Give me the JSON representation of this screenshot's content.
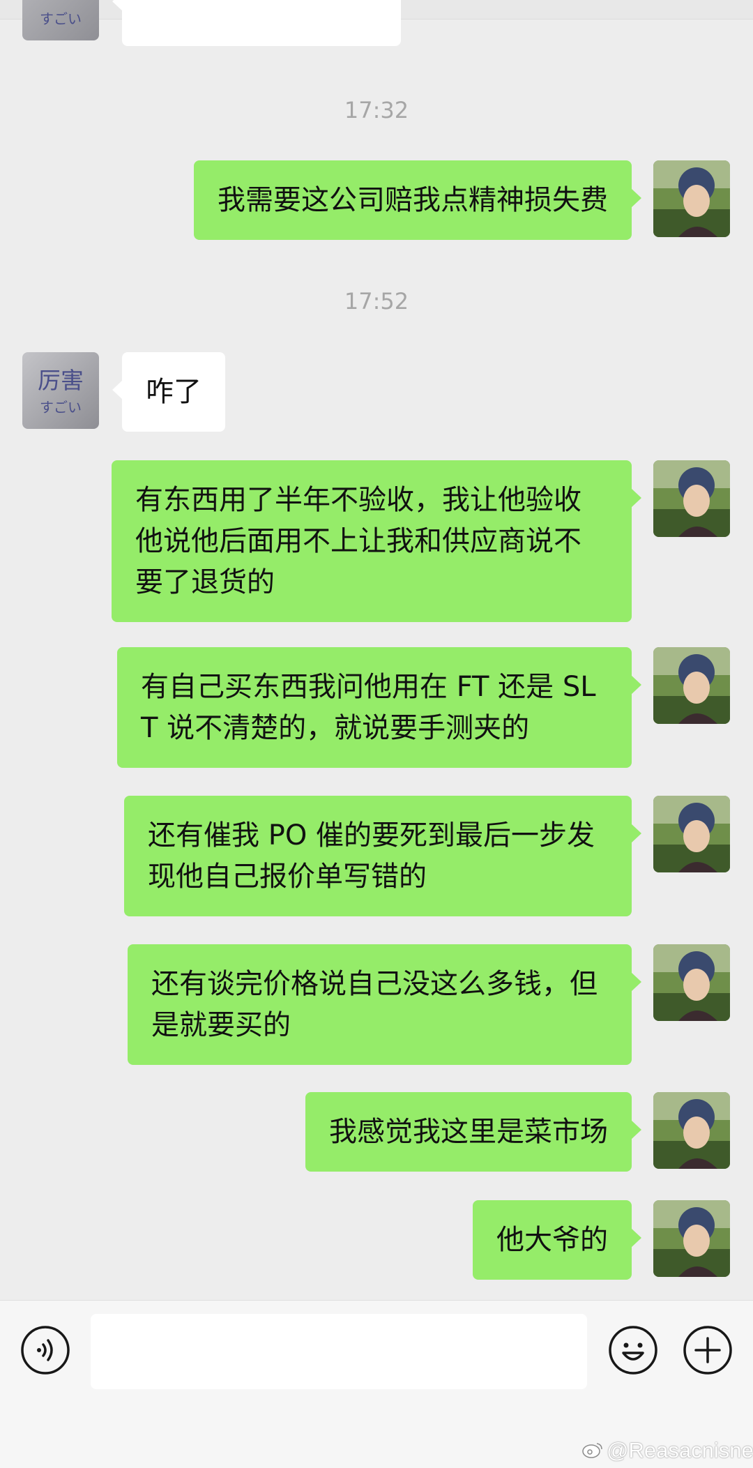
{
  "messages": [
    {
      "type": "timestamp",
      "text": "17:32"
    },
    {
      "type": "self",
      "text": "我需要这公司赔我点精神损失费"
    },
    {
      "type": "timestamp",
      "text": "17:52"
    },
    {
      "type": "other",
      "text": "咋了"
    },
    {
      "type": "self",
      "text": "有东西用了半年不验收，我让他验收他说他后面用不上让我和供应商说不要了退货的"
    },
    {
      "type": "self",
      "text": "有自己买东西我问他用在 FT 还是 SLT 说不清楚的，就说要手测夹的"
    },
    {
      "type": "self",
      "text": "还有催我 PO 催的要死到最后一步发现他自己报价单写错的"
    },
    {
      "type": "self",
      "text": "还有谈完价格说自己没这么多钱，但是就要买的"
    },
    {
      "type": "self",
      "text": "我感觉我这里是菜市场"
    },
    {
      "type": "self",
      "text": "他大爷的"
    }
  ],
  "contact_avatar": {
    "main_text": "厉害",
    "sub_text": "すごい"
  },
  "input_bar": {
    "value": "",
    "placeholder": ""
  },
  "icons": {
    "voice": "voice-icon",
    "emoji": "emoji-icon",
    "plus": "plus-icon"
  },
  "watermark": {
    "text": "@Reasacnisne"
  },
  "colors": {
    "background": "#ededed",
    "self_bubble": "#95ec69",
    "other_bubble": "#ffffff",
    "timestamp": "#a6a6a6"
  }
}
